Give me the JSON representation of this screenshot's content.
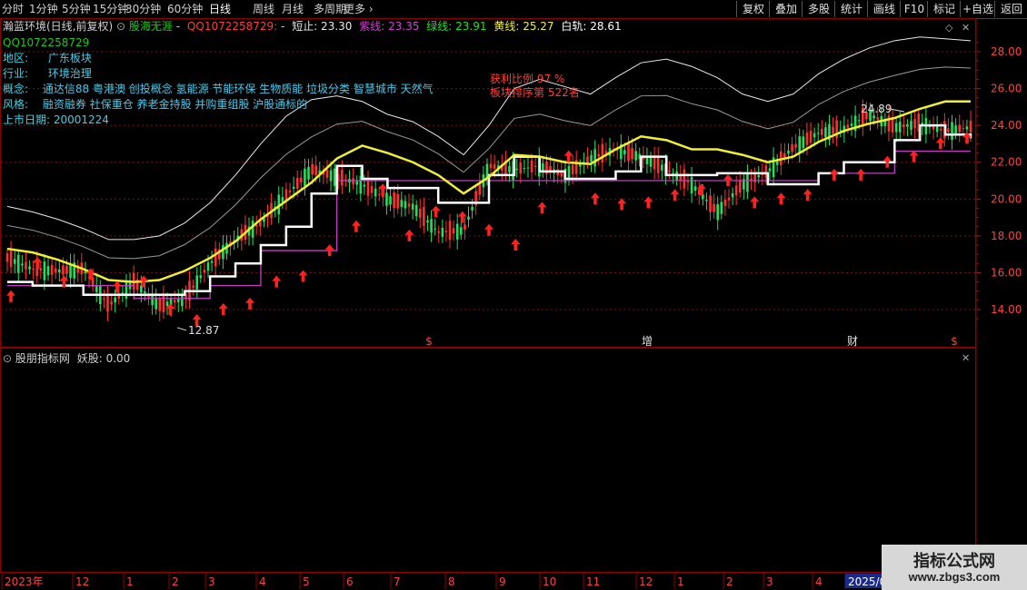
{
  "toolbar": {
    "timeframes": [
      "分时",
      "1分钟",
      "5分钟",
      "15分钟",
      "30分钟",
      "60分钟",
      "日线",
      "周线",
      "月线",
      "多周期",
      "更多"
    ],
    "active": "日线",
    "right_buttons": [
      "复权",
      "叠加",
      "多股",
      "统计",
      "画线",
      "F10",
      "标记",
      "+自选",
      "返回"
    ]
  },
  "header": {
    "stock": "瀚蓝环境(日线,前复权)",
    "indicator": "股海无涯",
    "indicator_sep": "-",
    "qq_label": "QQ1072258729:",
    "qq_value": "-",
    "short_stop": "短止: 23.30",
    "purple": "紫线: 23.35",
    "green": "绿线: 23.91",
    "yellow": "黄线: 25.27",
    "white": "白轨: 28.61"
  },
  "info_panel": {
    "qq": "QQ1072258729",
    "region_label": "地区:",
    "region_value": "广东板块",
    "industry_label": "行业:",
    "industry_value": "环境治理",
    "concept_label": "概念:",
    "concept_value": "通达信88 粤港澳 创投概念 氢能源 节能环保 生物质能 垃圾分类 智慧城市 天然气",
    "style_label": "风格:",
    "style_value": "融资融券 社保重仓 养老金持股 并购重组股 沪股通标的",
    "listing": "上市日期: 20001224"
  },
  "annotations": {
    "profit_ratio": "获利比例 97 %",
    "sector_rank": "板块排序第 522名",
    "high": "24.89",
    "low": "12.87"
  },
  "event_markers": [
    "$",
    "增",
    "财",
    "$"
  ],
  "sub_panel": {
    "title": "股朋指标网",
    "value": "妖股: 0.00"
  },
  "axis": {
    "price_ticks": [
      "28.00",
      "26.00",
      "24.00",
      "22.00",
      "20.00",
      "18.00",
      "16.00",
      "14.00"
    ],
    "dates": [
      "2023年",
      "12",
      "1",
      "2",
      "3",
      "4",
      "5",
      "6",
      "7",
      "8",
      "9",
      "10",
      "11",
      "12",
      "1",
      "2",
      "3",
      "4",
      "2025/04"
    ]
  },
  "watermark": {
    "title": "指标公式网",
    "url": "www.zbgs3.com"
  },
  "chart_data": {
    "type": "line",
    "ylim": [
      12.0,
      29.0
    ],
    "series": [
      {
        "name": "黄线",
        "values": [
          17.3,
          17.1,
          16.7,
          16.2,
          15.6,
          15.5,
          15.6,
          16.1,
          16.8,
          17.7,
          18.9,
          19.9,
          20.9,
          22.2,
          22.9,
          22.5,
          22.0,
          21.3,
          20.3,
          21.2,
          22.4,
          22.3,
          22.0,
          21.9,
          22.7,
          23.4,
          23.2,
          22.7,
          22.7,
          22.4,
          22.0,
          22.3,
          23.1,
          23.7,
          24.1,
          24.4,
          24.9,
          25.3,
          25.3
        ]
      },
      {
        "name": "白轨",
        "values": [
          19.6,
          19.3,
          18.9,
          18.4,
          17.8,
          17.8,
          18.0,
          18.7,
          19.8,
          21.3,
          23.0,
          24.5,
          25.4,
          25.6,
          25.3,
          24.6,
          24.2,
          23.4,
          22.4,
          24.0,
          26.0,
          26.5,
          26.1,
          25.7,
          26.6,
          27.4,
          27.6,
          27.2,
          26.6,
          25.7,
          25.3,
          25.7,
          26.8,
          27.6,
          28.2,
          28.6,
          28.8,
          28.7,
          28.6
        ]
      },
      {
        "name": "紫线",
        "values": [
          15.3,
          15.3,
          15.3,
          15.3,
          15.3,
          14.6,
          14.6,
          14.6,
          15.3,
          15.3,
          17.2,
          17.2,
          17.2,
          21.0,
          21.0,
          21.0,
          21.0,
          21.0,
          21.0,
          21.0,
          21.0,
          21.0,
          21.0,
          21.0,
          21.0,
          21.0,
          21.0,
          21.0,
          21.0,
          21.0,
          21.0,
          21.0,
          21.4,
          21.4,
          21.4,
          22.6,
          22.6,
          22.6,
          22.6
        ]
      },
      {
        "name": "短止",
        "values": [
          15.5,
          15.3,
          15.3,
          14.8,
          14.8,
          14.8,
          14.8,
          15.0,
          15.8,
          16.5,
          17.5,
          18.5,
          20.3,
          21.8,
          21.1,
          20.6,
          20.6,
          19.8,
          19.8,
          21.3,
          22.3,
          21.5,
          21.1,
          21.1,
          21.5,
          22.3,
          21.3,
          21.3,
          21.4,
          21.4,
          20.8,
          20.8,
          21.4,
          22.0,
          22.0,
          23.2,
          24.0,
          23.5,
          23.3
        ]
      },
      {
        "name": "close",
        "values": [
          16.8,
          16.2,
          16.1,
          16.2,
          14.2,
          15.5,
          14.2,
          14.6,
          16.5,
          17.8,
          18.7,
          20.2,
          21.6,
          21.2,
          20.8,
          20.0,
          19.6,
          18.2,
          18.3,
          21.8,
          21.6,
          21.8,
          21.3,
          22.2,
          22.7,
          22.3,
          21.6,
          20.8,
          19.3,
          20.8,
          21.5,
          22.8,
          23.6,
          23.8,
          24.6,
          23.9,
          24.1,
          23.7,
          23.9
        ]
      }
    ],
    "buy_arrows": [
      14.7,
      16.5,
      15.5,
      15.9,
      15.2,
      15.5,
      14.0,
      13.4,
      14.0,
      14.3,
      15.5,
      15.8,
      17.2,
      18.5,
      20.5,
      18.0,
      19.3,
      19.0,
      18.3,
      17.5,
      19.5,
      22.3,
      20.0,
      19.7,
      19.8,
      20.2,
      20.5,
      21.0,
      19.8,
      20.0,
      20.2,
      21.3,
      21.3,
      22.0,
      22.3,
      23.0,
      23.3
    ]
  }
}
